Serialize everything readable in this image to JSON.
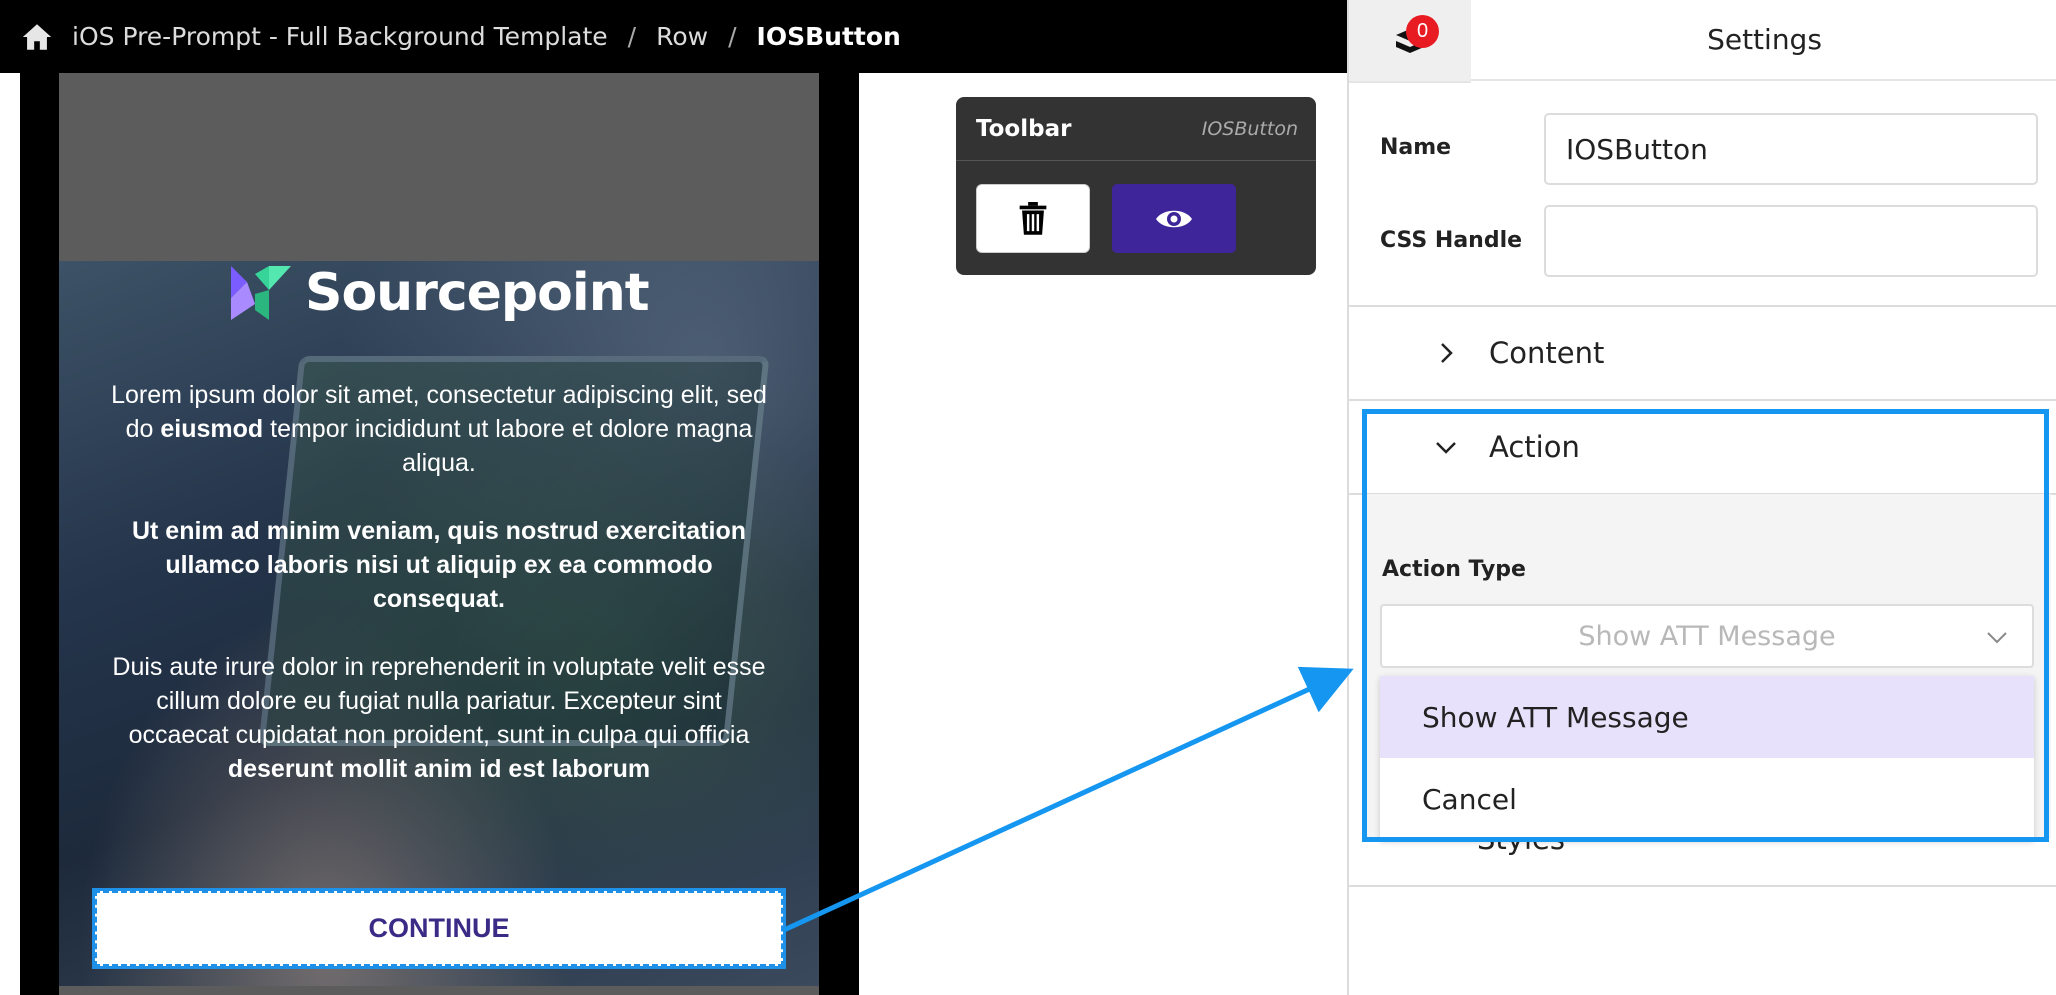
{
  "breadcrumb": {
    "items": [
      "iOS Pre-Prompt - Full Background Template",
      "Row",
      "IOSButton"
    ],
    "separator": "/"
  },
  "preview": {
    "logo_text": "Sourcepoint",
    "paragraph1_a": "Lorem ipsum dolor sit amet, consectetur adipiscing elit, sed do ",
    "paragraph1_bold": "eiusmod",
    "paragraph1_b": " tempor incididunt ut labore et dolore magna aliqua.",
    "paragraph2": "Ut enim ad minim veniam, quis nostrud exercitation ullamco laboris nisi ut aliquip ex ea commodo consequat.",
    "paragraph3_a": "Duis aute irure dolor in reprehenderit in voluptate velit esse cillum dolore eu fugiat nulla pariatur. Excepteur sint occaecat cupidatat non proident, sunt in culpa qui officia ",
    "paragraph3_bold": "deserunt mollit anim id est laborum",
    "continue_label": "CONTINUE"
  },
  "toolbar": {
    "title": "Toolbar",
    "subtitle": "IOSButton",
    "delete_icon": "trash-icon",
    "preview_icon": "eye-icon"
  },
  "panel": {
    "badge_count": "0",
    "title": "Settings",
    "name_label": "Name",
    "name_value": "IOSButton",
    "css_handle_label": "CSS Handle",
    "css_handle_value": "",
    "sections": {
      "content": "Content",
      "action": "Action",
      "styles": "Styles"
    },
    "action_type_label": "Action Type",
    "action_type_value": "Show ATT Message",
    "action_options": [
      "Show ATT Message",
      "Cancel"
    ]
  },
  "colors": {
    "accent": "#3f259a",
    "highlight": "#1596f0",
    "badge": "#e81b23",
    "selected_option": "#e8e1fb"
  }
}
